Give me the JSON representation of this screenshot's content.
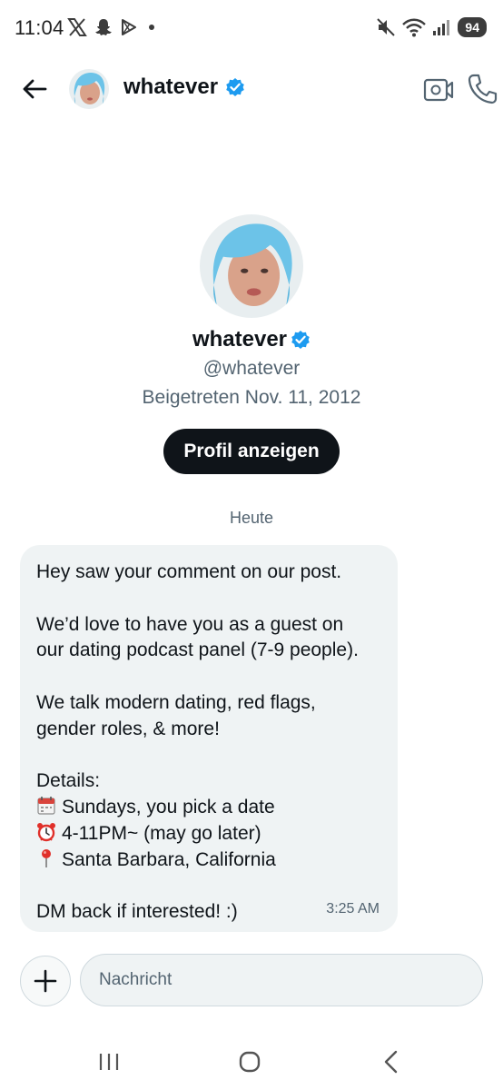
{
  "status_bar": {
    "time": "11:04",
    "battery": "94",
    "left_icons": [
      "x-icon",
      "snapchat-icon",
      "play-store-icon",
      "dot-icon"
    ],
    "right_icons": [
      "mute-icon",
      "wifi-icon",
      "signal-icon"
    ]
  },
  "header": {
    "name": "whatever",
    "verified": true,
    "actions": [
      "video-call-icon",
      "phone-icon"
    ]
  },
  "profile": {
    "name": "whatever",
    "handle": "@whatever",
    "joined": "Beigetreten Nov. 11, 2012",
    "button_label": "Profil anzeigen"
  },
  "date_separator": "Heute",
  "message": {
    "lines": {
      "l1": "Hey saw your comment on our post.",
      "l2": "We’d love to have you as a guest on",
      "l3": "our dating podcast panel (7-9 people).",
      "l4": "We talk modern dating, red flags,",
      "l5": "gender roles, & more!",
      "l6": "Details:",
      "l7": "Sundays, you pick a date",
      "l8": "4-11PM~ (may go later)",
      "l9": "Santa Barbara, California",
      "l10": "DM back if interested! :)"
    },
    "time": "3:25 AM"
  },
  "composer": {
    "placeholder": "Nachricht"
  },
  "colors": {
    "verified_blue": "#1d9bf0",
    "bubble_bg": "#eff3f4",
    "button_bg": "#0f1419",
    "muted_text": "#536471"
  }
}
